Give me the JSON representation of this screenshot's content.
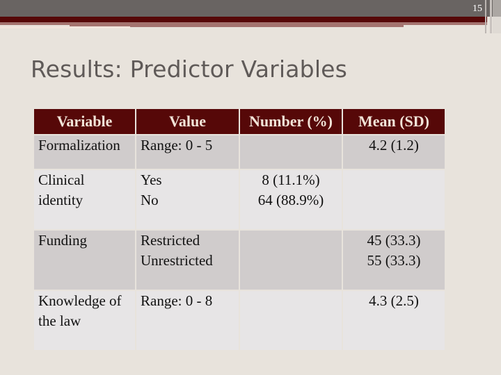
{
  "slide": {
    "page_number": "15",
    "title": "Results: Predictor Variables"
  },
  "colors": {
    "header_bg": "#560808",
    "header_text": "#f2e4d8",
    "row_dark": "#d0cccc",
    "row_light": "#e7e5e6",
    "background": "#e8e3dc",
    "title_text": "#5f5a58"
  },
  "table": {
    "headers": [
      "Variable",
      "Value",
      "Number (%)",
      "Mean (SD)"
    ],
    "rows": [
      {
        "variable": [
          "Formalization"
        ],
        "value": [
          "Range: 0 - 5"
        ],
        "number": [],
        "mean": [
          "4.2 (1.2)"
        ]
      },
      {
        "variable": [
          "Clinical",
          "identity"
        ],
        "value": [
          "Yes",
          "No"
        ],
        "number": [
          "8 (11.1%)",
          "64 (88.9%)"
        ],
        "mean": []
      },
      {
        "variable": [
          "Funding"
        ],
        "value": [
          "Restricted",
          "Unrestricted"
        ],
        "number": [],
        "mean": [
          "45 (33.3)",
          "55 (33.3)"
        ]
      },
      {
        "variable": [
          "Knowledge of",
          "the law"
        ],
        "value": [
          "Range: 0 - 8"
        ],
        "number": [],
        "mean": [
          "4.3 (2.5)"
        ]
      }
    ]
  }
}
